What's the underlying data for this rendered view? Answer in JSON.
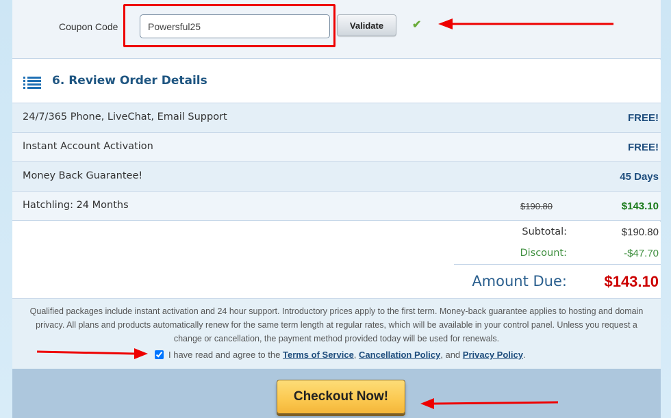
{
  "coupon": {
    "label": "Coupon Code",
    "value": "Powersful25",
    "validate_label": "Validate",
    "status_icon": "check-icon",
    "status_glyph": "✔",
    "status_color": "#6aab3a"
  },
  "section": {
    "icon": "list-icon",
    "title": "6. Review Order Details"
  },
  "order_items": [
    {
      "name": "24/7/365 Phone, LiveChat, Email Support",
      "value": "FREE!"
    },
    {
      "name": "Instant Account Activation",
      "value": "FREE!"
    },
    {
      "name": "Money Back Guarantee!",
      "value": "45 Days"
    },
    {
      "name": "Hatchling: 24 Months",
      "old_price": "$190.80",
      "value": "$143.10"
    }
  ],
  "totals": {
    "subtotal_label": "Subtotal:",
    "subtotal_value": "$190.80",
    "discount_label": "Discount:",
    "discount_value": "-$47.70",
    "amount_due_label": "Amount Due:",
    "amount_due_value": "$143.10"
  },
  "terms": {
    "text": "Qualified packages include instant activation and 24 hour support. Introductory prices apply to the first term. Money-back guarantee applies to hosting and domain privacy. All plans and products automatically renew for the same term length at regular rates, which will be available in your control panel. Unless you request a change or cancellation, the payment method provided today will be used for renewals.",
    "agree_prefix": "I have read and agree to the",
    "tos_link": "Terms of Service",
    "sep1": ",",
    "cancellation_link": "Cancellation Policy",
    "sep2": ", and",
    "privacy_link": "Privacy Policy",
    "suffix": ".",
    "agree_checked": true
  },
  "checkout": {
    "label": "Checkout Now!"
  },
  "colors": {
    "accent_blue": "#1e5581",
    "price_green": "#1a7a1a",
    "amount_due_red": "#cc0000",
    "annotation_red": "#ee0000",
    "checkout_yellow": "#fbc84f"
  }
}
